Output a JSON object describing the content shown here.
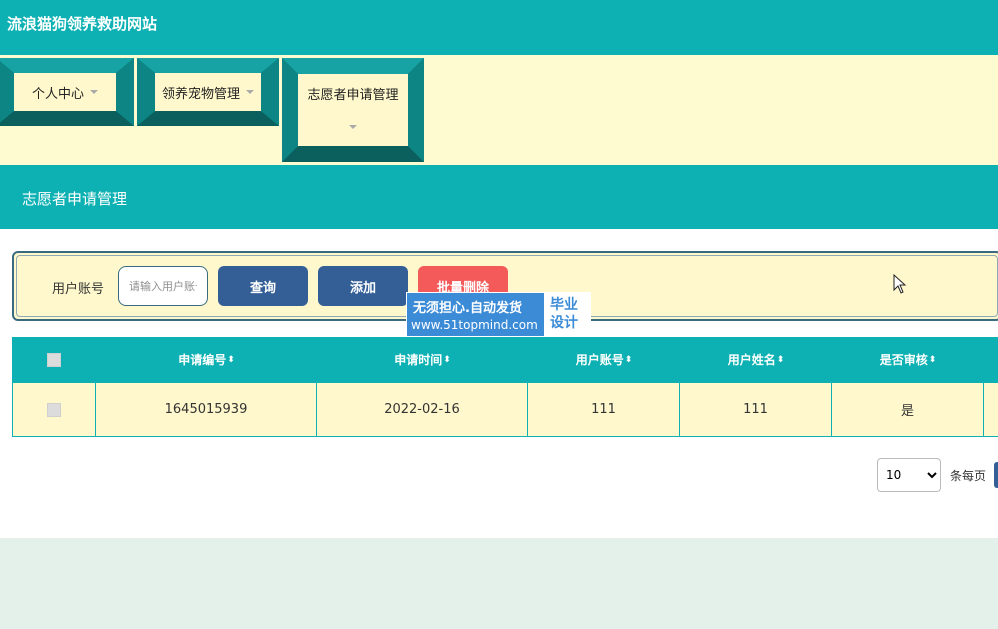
{
  "header": {
    "site_title": "流浪猫狗领养救助网站"
  },
  "nav": {
    "items": [
      {
        "label": "个人中心"
      },
      {
        "label": "领养宠物管理"
      },
      {
        "label": "志愿者申请管理"
      }
    ]
  },
  "section": {
    "title": "志愿者申请管理"
  },
  "search": {
    "label": "用户账号",
    "placeholder": "请输入用户账号",
    "query_label": "查询",
    "add_label": "添加",
    "batch_delete_label": "批量删除"
  },
  "watermark": {
    "line1": "无须担心.自动发货",
    "line2": "www.51topmind.com",
    "right_line1": "毕业",
    "right_line2": "设计"
  },
  "table": {
    "columns": [
      "申请编号",
      "申请时间",
      "用户账号",
      "用户姓名",
      "是否审核"
    ],
    "rows": [
      {
        "id": "1645015939",
        "time": "2022-02-16",
        "account": "111",
        "name": "111",
        "reviewed": "是"
      }
    ]
  },
  "pagination": {
    "page_size": "10",
    "page_size_options": [
      "10"
    ],
    "per_page_label": "条每页"
  },
  "colors": {
    "teal": "#0db1b3",
    "cream": "#fff8cc",
    "dark_teal": "#0f6f6b",
    "button_blue": "#335f96",
    "button_red": "#f35a59"
  }
}
